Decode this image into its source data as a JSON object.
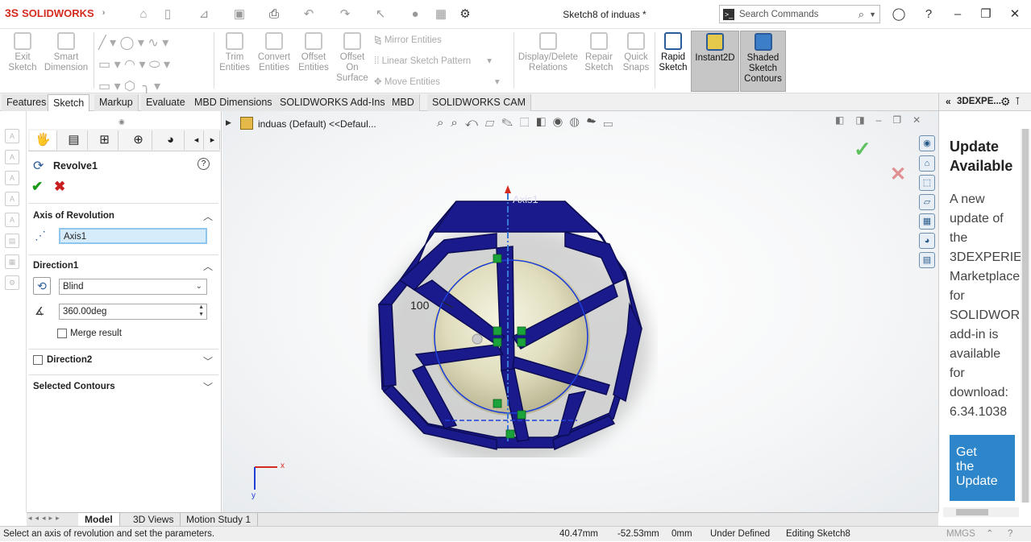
{
  "app": {
    "name": "SOLIDWORKS",
    "document_title": "Sketch8 of induas *"
  },
  "search": {
    "placeholder": "Search Commands"
  },
  "ribbon": {
    "exit_sketch": "Exit Sketch",
    "smart_dimension": "Smart Dimension",
    "trim_entities": "Trim Entities",
    "convert_entities": "Convert Entities",
    "offset_entities": "Offset Entities",
    "offset_on_surface": "Offset On Surface",
    "mirror_entities": "Mirror Entities",
    "linear_sketch_pattern": "Linear Sketch Pattern",
    "move_entities": "Move Entities",
    "display_delete_relations": "Display/Delete Relations",
    "repair_sketch": "Repair Sketch",
    "quick_snaps": "Quick Snaps",
    "rapid_sketch": "Rapid Sketch",
    "instant2d": "Instant2D",
    "shaded_sketch_contours": "Shaded Sketch Contours"
  },
  "tabs": [
    "Features",
    "Sketch",
    "Markup",
    "Evaluate",
    "MBD Dimensions",
    "SOLIDWORKS Add-Ins",
    "MBD",
    "SOLIDWORKS CAM"
  ],
  "active_tab": "Sketch",
  "property_manager": {
    "feature_name": "Revolve1",
    "axis_section": "Axis of Revolution",
    "axis_value": "Axis1",
    "direction1_section": "Direction1",
    "end_condition": "Blind",
    "angle": "360.00deg",
    "merge_result": "Merge result",
    "direction2_section": "Direction2",
    "selected_contours_section": "Selected Contours"
  },
  "viewport": {
    "tree_label": "induas (Default) <<Defaul...",
    "axis_label": "Axis1",
    "dimension_label": "100",
    "triad_x": "x",
    "triad_y": "y"
  },
  "task_pane": {
    "header": "3DEXPE...",
    "update_title_line1": "Update",
    "update_title_line2": "Available",
    "update_body": [
      "A new",
      "update of",
      "the",
      "3DEXPERIE",
      "Marketplace",
      "for",
      "SOLIDWOR",
      "add-in is",
      "available",
      "for",
      "download:",
      "6.34.1038"
    ],
    "button_line1": "Get",
    "button_line2": "the",
    "button_line3": "Update"
  },
  "bottom_tabs": [
    "Model",
    "3D Views",
    "Motion Study 1"
  ],
  "status_bar": {
    "message": "Select an axis of revolution and set the parameters.",
    "x": "40.47mm",
    "y": "-52.53mm",
    "z": "0mm",
    "state": "Under Defined",
    "editing": "Editing Sketch8",
    "units": "MMGS"
  },
  "colors": {
    "model": "#1a1a8c",
    "sphere": "#e8e6c8",
    "accent": "#d52b1e",
    "sketch": "#1f3fd6",
    "relation": "#1aa33a"
  }
}
